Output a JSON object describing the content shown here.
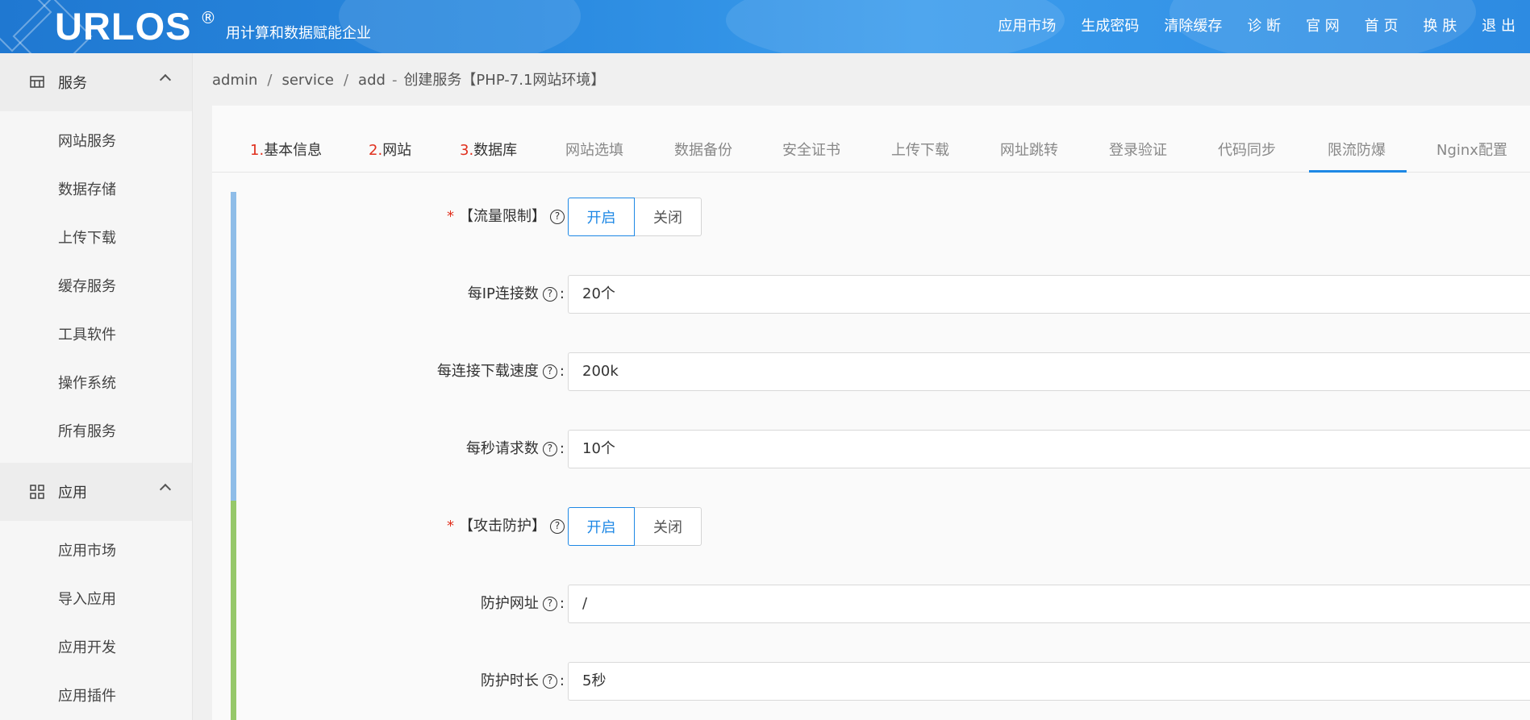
{
  "header": {
    "logo": "URLOS",
    "logo_mark": "®",
    "slogan": "用计算和数据赋能企业",
    "nav": [
      "应用市场",
      "生成密码",
      "清除缓存",
      "诊 断",
      "官 网",
      "首 页",
      "换 肤",
      "退 出"
    ]
  },
  "sidebar": {
    "groups": [
      {
        "label": "服务",
        "icon": "server-icon",
        "items": [
          "网站服务",
          "数据存储",
          "上传下载",
          "缓存服务",
          "工具软件",
          "操作系统",
          "所有服务"
        ]
      },
      {
        "label": "应用",
        "icon": "grid-icon",
        "items": [
          "应用市场",
          "导入应用",
          "应用开发",
          "应用插件"
        ]
      }
    ]
  },
  "breadcrumb": {
    "parts": [
      "admin",
      "service",
      "add"
    ],
    "suffix": "创建服务【PHP-7.1网站环境】"
  },
  "tabs": [
    {
      "num": "1.",
      "label": "基本信息"
    },
    {
      "num": "2.",
      "label": "网站"
    },
    {
      "num": "3.",
      "label": "数据库"
    },
    {
      "num": "",
      "label": "网站选填"
    },
    {
      "num": "",
      "label": "数据备份"
    },
    {
      "num": "",
      "label": "安全证书"
    },
    {
      "num": "",
      "label": "上传下载"
    },
    {
      "num": "",
      "label": "网址跳转"
    },
    {
      "num": "",
      "label": "登录验证"
    },
    {
      "num": "",
      "label": "代码同步"
    },
    {
      "num": "",
      "label": "限流防爆"
    },
    {
      "num": "",
      "label": "Nginx配置"
    }
  ],
  "active_tab": "限流防爆",
  "form": {
    "rate_limit": {
      "label": "【流量限制】",
      "on": "开启",
      "off": "关闭"
    },
    "per_ip_conn": {
      "label": "每IP连接数",
      "value": "20个"
    },
    "per_conn_speed": {
      "label": "每连接下载速度",
      "value": "200k"
    },
    "req_per_sec": {
      "label": "每秒请求数",
      "value": "10个"
    },
    "attack_protect": {
      "label": "【攻击防护】",
      "on": "开启",
      "off": "关闭"
    },
    "protect_url": {
      "label": "防护网址",
      "value": "/"
    },
    "protect_duration": {
      "label": "防护时长",
      "value": "5秒"
    }
  },
  "colors": {
    "accent": "#1e88e5",
    "required": "#e0301e",
    "section_blue": "#8fbde8",
    "section_green": "#96c86a"
  }
}
